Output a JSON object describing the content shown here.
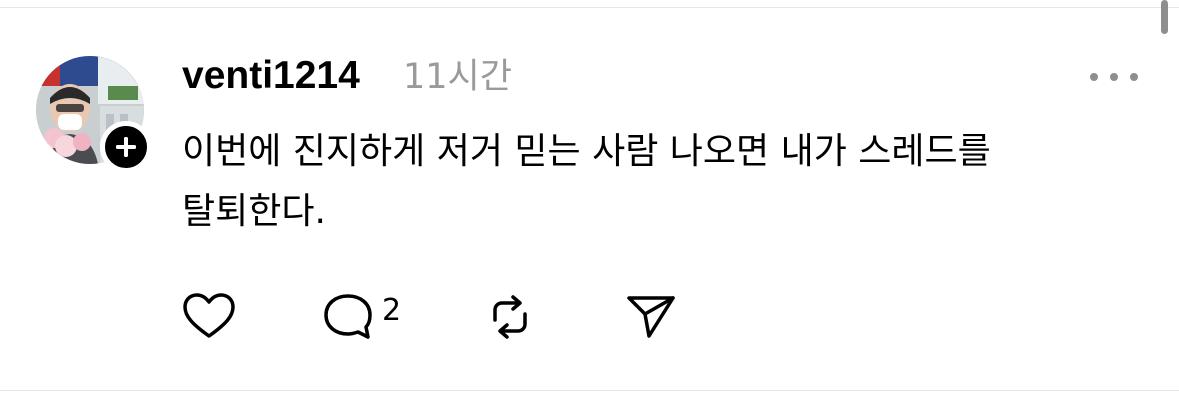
{
  "post": {
    "username": "venti1214",
    "timestamp": "11시간",
    "text": "이번에 진지하게 저거 믿는 사람 나오면 내가 스레드를\n탈퇴한다."
  },
  "actions": {
    "reply_count": "2"
  },
  "icons": {
    "avatar": "profile-photo",
    "follow": "plus-icon",
    "more": "more-horizontal-icon",
    "like": "heart-icon",
    "reply": "speech-bubble-icon",
    "repost": "repost-icon",
    "share": "send-icon"
  },
  "colors": {
    "text": "#000000",
    "muted": "#9a9a9a",
    "divider": "#e7e7e7",
    "badge": "#000000"
  }
}
